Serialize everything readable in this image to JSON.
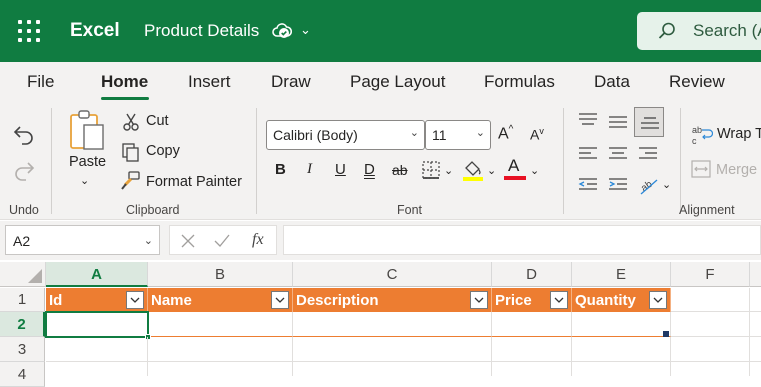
{
  "app": {
    "name": "Excel",
    "doc_title": "Product Details",
    "search_placeholder": "Search (A"
  },
  "tabs": [
    {
      "label": "File"
    },
    {
      "label": "Home",
      "active": true
    },
    {
      "label": "Insert"
    },
    {
      "label": "Draw"
    },
    {
      "label": "Page Layout"
    },
    {
      "label": "Formulas"
    },
    {
      "label": "Data"
    },
    {
      "label": "Review"
    }
  ],
  "ribbon": {
    "undo_group": "Undo",
    "clipboard": {
      "group": "Clipboard",
      "paste": "Paste",
      "cut": "Cut",
      "copy": "Copy",
      "format_painter": "Format Painter"
    },
    "font": {
      "group": "Font",
      "family": "Calibri (Body)",
      "size": "11",
      "bold": "B",
      "italic": "I",
      "underline": "U",
      "double_underline": "D",
      "strikethrough": "ab",
      "font_color_glyph": "A",
      "highlight_color": "#ffff00",
      "font_color": "#e81123"
    },
    "alignment": {
      "group": "Alignment",
      "wrap_text": "Wrap T",
      "merge": "Merge"
    }
  },
  "formula_bar": {
    "name_box": "A2",
    "formula": ""
  },
  "grid": {
    "columns": [
      "A",
      "B",
      "C",
      "D",
      "E",
      "F"
    ],
    "selected_column": "A",
    "rows": [
      "1",
      "2",
      "3",
      "4"
    ],
    "selected_row": "2",
    "selected_cell": "A2",
    "table_headers": [
      "Id",
      "Name",
      "Description",
      "Price",
      "Quantity"
    ]
  },
  "colors": {
    "brand": "#107c41",
    "table_header": "#ed7d31"
  }
}
